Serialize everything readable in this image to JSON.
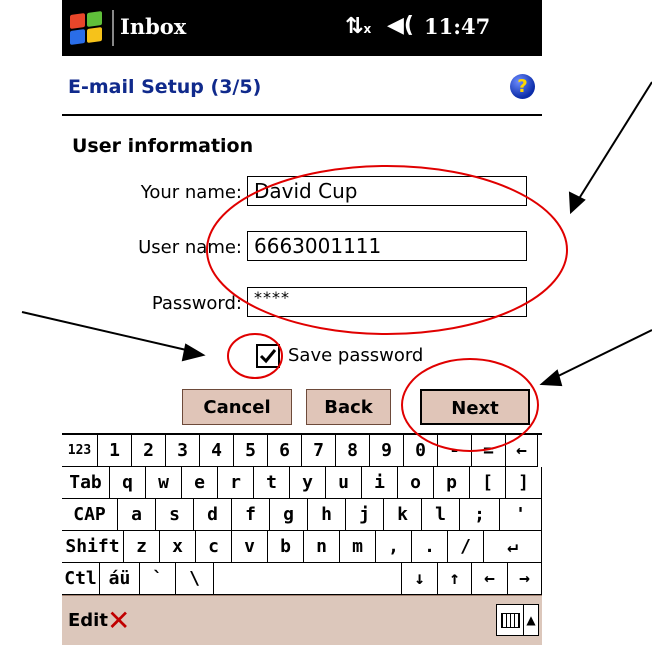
{
  "titlebar": {
    "app_name": "Inbox",
    "clock": "11:47",
    "connection_icon": "antenna-off-icon",
    "speaker_icon": "speaker-icon"
  },
  "header": {
    "title": "E-mail Setup (3/5)",
    "help": "?"
  },
  "form": {
    "section_title": "User information",
    "your_name_label": "Your name:",
    "your_name_value": "David Cup",
    "user_name_label": "User name:",
    "user_name_value": "6663001111",
    "password_label": "Password:",
    "password_value": "****",
    "save_password_label": "Save password",
    "save_password_checked": true
  },
  "buttons": {
    "cancel": "Cancel",
    "back": "Back",
    "next": "Next"
  },
  "keyboard": {
    "rows": [
      [
        "123",
        "1",
        "2",
        "3",
        "4",
        "5",
        "6",
        "7",
        "8",
        "9",
        "0",
        "-",
        "=",
        "←"
      ],
      [
        "Tab",
        "q",
        "w",
        "e",
        "r",
        "t",
        "y",
        "u",
        "i",
        "o",
        "p",
        "[",
        "]"
      ],
      [
        "CAP",
        "a",
        "s",
        "d",
        "f",
        "g",
        "h",
        "j",
        "k",
        "l",
        ";",
        "'"
      ],
      [
        "Shift",
        "z",
        "x",
        "c",
        "v",
        "b",
        "n",
        "m",
        ",",
        ".",
        "/",
        "↵"
      ],
      [
        "Ctl",
        "áü",
        "`",
        "\\",
        "",
        "↓",
        "↑",
        "←",
        "→"
      ]
    ]
  },
  "bottombar": {
    "menu": "Edit",
    "close_icon": "✕"
  },
  "colors": {
    "title_bar": "#000000",
    "header_text": "#102a8c",
    "button_bg": "#e0c5b8",
    "bottom_bar": "#dcc7bb",
    "annotation": "#e00000"
  }
}
